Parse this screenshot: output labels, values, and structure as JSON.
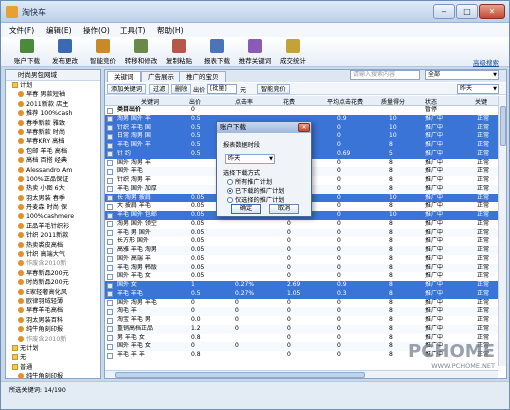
{
  "window": {
    "title": "淘快车",
    "min_label": "‒",
    "max_label": "□",
    "close_label": "✕"
  },
  "menu": [
    "文件(F)",
    "编辑(E)",
    "操作(O)",
    "工具(T)",
    "帮助(H)"
  ],
  "toolbar": {
    "items": [
      {
        "label": "账户下载",
        "icon": "account-download-icon",
        "color": "#4a8a3a"
      },
      {
        "label": "发布更改",
        "icon": "publish-icon",
        "color": "#3a6ab4"
      },
      {
        "label": "智能竞价",
        "icon": "smart-bid-icon",
        "color": "#c88a28"
      },
      {
        "label": "转移和修改",
        "icon": "transfer-icon",
        "color": "#6a8a4a"
      },
      {
        "label": "复制粘贴",
        "icon": "copy-paste-icon",
        "color": "#b4584a"
      },
      {
        "label": "报表下载",
        "icon": "report-download-icon",
        "color": "#4a74b4"
      },
      {
        "label": "推荐关键词",
        "icon": "keyword-icon",
        "color": "#8a5ab4"
      },
      {
        "label": "成交统计",
        "icon": "stats-icon",
        "color": "#c4a23a"
      }
    ],
    "advanced_search": "高级搜索"
  },
  "tree": {
    "header": "时尚男包网域",
    "items": [
      {
        "label": "计划",
        "kind": "folder",
        "state": ""
      },
      {
        "label": "早春 男款短袖",
        "kind": "item",
        "state": ""
      },
      {
        "label": "2011新款 店主",
        "kind": "item",
        "state": ""
      },
      {
        "label": "推荐 100%cash",
        "kind": "item",
        "state": ""
      },
      {
        "label": "春季新款 雅致",
        "kind": "item",
        "state": ""
      },
      {
        "label": "早春新款 时尚",
        "kind": "item",
        "state": ""
      },
      {
        "label": "早春KRY 高档",
        "kind": "item",
        "state": ""
      },
      {
        "label": "包邮 羊毛 高档",
        "kind": "item",
        "state": ""
      },
      {
        "label": "高档 百搭 经典",
        "kind": "item",
        "state": ""
      },
      {
        "label": "Alessandro Am",
        "kind": "item",
        "state": ""
      },
      {
        "label": "100%正品保证",
        "kind": "item",
        "state": ""
      },
      {
        "label": "热卖 小图 6大",
        "kind": "item",
        "state": ""
      },
      {
        "label": "羽太男装 春季",
        "kind": "item",
        "state": ""
      },
      {
        "label": "丹麦森 时尚 保",
        "kind": "item",
        "state": ""
      },
      {
        "label": "100%cashmere",
        "kind": "item",
        "state": ""
      },
      {
        "label": "正品羊毛针织衫",
        "kind": "item",
        "state": ""
      },
      {
        "label": "针织 2011新款",
        "kind": "item",
        "state": ""
      },
      {
        "label": "热卖裘皮高档",
        "kind": "item",
        "state": ""
      },
      {
        "label": "针织 高端大气",
        "kind": "item",
        "state": ""
      },
      {
        "label": "作废含2010新",
        "kind": "item",
        "state": "dim"
      },
      {
        "label": "早春新品200元",
        "kind": "item",
        "state": ""
      },
      {
        "label": "时尚新品200元",
        "kind": "item",
        "state": ""
      },
      {
        "label": "E家轻奢高化风",
        "kind": "item",
        "state": ""
      },
      {
        "label": "欧律羽绒轻薄",
        "kind": "item",
        "state": ""
      },
      {
        "label": "早春羊毛高档",
        "kind": "item",
        "state": ""
      },
      {
        "label": "羽太男装百科",
        "kind": "item",
        "state": ""
      },
      {
        "label": "纯牛角刻印报",
        "kind": "item",
        "state": ""
      },
      {
        "label": "作废含2010新",
        "kind": "item",
        "state": "dim"
      },
      {
        "label": "无计划",
        "kind": "folder",
        "state": ""
      },
      {
        "label": "无",
        "kind": "folder",
        "state": ""
      },
      {
        "label": "普通",
        "kind": "folder",
        "state": ""
      },
      {
        "label": "纯牛角刻印报",
        "kind": "item",
        "state": ""
      },
      {
        "label": "早春新品200元",
        "kind": "item",
        "state": ""
      },
      {
        "label": "超级方阵背景",
        "kind": "item",
        "state": "sel"
      },
      {
        "label": "作废含2010新",
        "kind": "item",
        "state": "dim"
      }
    ]
  },
  "tabs": [
    "关键词",
    "广告展示",
    "推广的宝贝"
  ],
  "search": {
    "placeholder": "请输入搜索内容"
  },
  "filter_combo": "全部",
  "subbar": {
    "add_keyword": "添加关键词",
    "filter": "过滤",
    "delete": "删除",
    "bid_label": "出价",
    "bid_value": "[批量]",
    "unit": "元",
    "smart_bid": "智能竞价",
    "period": "昨天"
  },
  "grid": {
    "headers": [
      "关键词",
      "出价",
      "点击率",
      "花费",
      "平均点击花费",
      "质量得分",
      "状态",
      "关键"
    ],
    "rows": [
      {
        "kw": "类目出价",
        "bid": "0",
        "ctr": "",
        "cost": "",
        "cpc": "",
        "qs": "",
        "status": "暂停",
        "extra": "",
        "style": "bold"
      },
      {
        "kw": "淘男 国外 羊",
        "bid": "0.5",
        "ctr": "",
        "cost": "",
        "cpc": "0.9",
        "qs": "10",
        "status": "推广中",
        "extra": "正常",
        "style": "sel"
      },
      {
        "kw": "针织 羊毛 国",
        "bid": "0.5",
        "ctr": "0",
        "cost": "0",
        "cpc": "0",
        "qs": "10",
        "status": "推广中",
        "extra": "正常",
        "style": "sel"
      },
      {
        "kw": "日常 淘男 国",
        "bid": "0.5",
        "ctr": "0",
        "cost": "0",
        "cpc": "0",
        "qs": "10",
        "status": "推广中",
        "extra": "正常",
        "style": "sel"
      },
      {
        "kw": "羊毛 国外 羊",
        "bid": "0.5",
        "ctr": "",
        "cost": "",
        "cpc": "0",
        "qs": "8",
        "status": "推广中",
        "extra": "正常",
        "style": "sel"
      },
      {
        "kw": "针 约",
        "bid": "0.5",
        "ctr": "",
        "cost": "",
        "cpc": "0.69",
        "qs": "5",
        "status": "推广中",
        "extra": "正常",
        "style": "sel"
      },
      {
        "kw": "国外 淘男 羊",
        "bid": "",
        "ctr": "",
        "cost": "",
        "cpc": "0",
        "qs": "8",
        "status": "推广中",
        "extra": "正常",
        "style": ""
      },
      {
        "kw": "国外 羊毛",
        "bid": "",
        "ctr": "",
        "cost": "",
        "cpc": "0",
        "qs": "8",
        "status": "推广中",
        "extra": "正常",
        "style": "alt"
      },
      {
        "kw": "针织 淘男 羊",
        "bid": "",
        "ctr": "",
        "cost": "",
        "cpc": "0",
        "qs": "8",
        "status": "推广中",
        "extra": "正常",
        "style": ""
      },
      {
        "kw": "羊毛 国外 加厚",
        "bid": "",
        "ctr": "",
        "cost": "",
        "cpc": "0",
        "qs": "8",
        "status": "推广中",
        "extra": "正常",
        "style": "alt"
      },
      {
        "kw": "长 淘男 披肩",
        "bid": "0.05",
        "ctr": "",
        "cost": "",
        "cpc": "0",
        "qs": "10",
        "status": "推广中",
        "extra": "正常",
        "style": "sel"
      },
      {
        "kw": "大 披肩 羊毛",
        "bid": "0.05",
        "ctr": "",
        "cost": "0",
        "cpc": "0",
        "qs": "8",
        "status": "推广中",
        "extra": "正常",
        "style": ""
      },
      {
        "kw": "羊毛 国外 包邮",
        "bid": "0.05",
        "ctr": "0",
        "cost": "0",
        "cpc": "0",
        "qs": "10",
        "status": "推广中",
        "extra": "正常",
        "style": "sel"
      },
      {
        "kw": "淘男 国外 领空",
        "bid": "0.05",
        "ctr": "",
        "cost": "0",
        "cpc": "0",
        "qs": "8",
        "status": "推广中",
        "extra": "正常",
        "style": ""
      },
      {
        "kw": "羊毛 男 国外",
        "bid": "0.05",
        "ctr": "",
        "cost": "0",
        "cpc": "0",
        "qs": "8",
        "status": "推广中",
        "extra": "正常",
        "style": "alt"
      },
      {
        "kw": "长方形 国外",
        "bid": "0.05",
        "ctr": "",
        "cost": "0",
        "cpc": "0",
        "qs": "8",
        "status": "推广中",
        "extra": "正常",
        "style": ""
      },
      {
        "kw": "高雅 羊毛 淘男",
        "bid": "0.05",
        "ctr": "",
        "cost": "0",
        "cpc": "0",
        "qs": "8",
        "status": "推广中",
        "extra": "正常",
        "style": "alt"
      },
      {
        "kw": "国外 高端 羊",
        "bid": "0.05",
        "ctr": "",
        "cost": "0",
        "cpc": "0",
        "qs": "8",
        "status": "推广中",
        "extra": "正常",
        "style": ""
      },
      {
        "kw": "羊毛 淘男 韩版",
        "bid": "0.05",
        "ctr": "",
        "cost": "0",
        "cpc": "0",
        "qs": "8",
        "status": "推广中",
        "extra": "正常",
        "style": "alt"
      },
      {
        "kw": "国外 羊毛 女",
        "bid": "0.05",
        "ctr": "",
        "cost": "0",
        "cpc": "0",
        "qs": "8",
        "status": "推广中",
        "extra": "正常",
        "style": ""
      },
      {
        "kw": "国外 女",
        "bid": "1",
        "ctr": "0.27%",
        "cost": "2.69",
        "cpc": "0.9",
        "qs": "8",
        "status": "推广中",
        "extra": "正常",
        "style": "sel"
      },
      {
        "kw": "羊毛 羊毛",
        "bid": "0.5",
        "ctr": "0.27%",
        "cost": "1.05",
        "cpc": "0.3",
        "qs": "8",
        "status": "推广中",
        "extra": "正常",
        "style": "sel"
      },
      {
        "kw": "国外 淘男 羊毛",
        "bid": "0",
        "ctr": "0",
        "cost": "0",
        "cpc": "0",
        "qs": "8",
        "status": "推广中",
        "extra": "正常",
        "style": ""
      },
      {
        "kw": "淘毛 羊",
        "bid": "0",
        "ctr": "0",
        "cost": "0",
        "cpc": "0",
        "qs": "8",
        "status": "推广中",
        "extra": "正常",
        "style": "alt"
      },
      {
        "kw": "淘宝 羊毛 男",
        "bid": "0.0",
        "ctr": "0",
        "cost": "0",
        "cpc": "0",
        "qs": "8",
        "status": "推广中",
        "extra": "正常",
        "style": ""
      },
      {
        "kw": "重销高档正品",
        "bid": "1.2",
        "ctr": "0",
        "cost": "0",
        "cpc": "0",
        "qs": "8",
        "status": "推广中",
        "extra": "正常",
        "style": "alt"
      },
      {
        "kw": "男 羊毛 女",
        "bid": "0.8",
        "ctr": "",
        "cost": "0",
        "cpc": "0",
        "qs": "8",
        "status": "推广中",
        "extra": "正常",
        "style": ""
      },
      {
        "kw": "国外 羊毛 女",
        "bid": "0",
        "ctr": "0",
        "cost": "0",
        "cpc": "0",
        "qs": "8",
        "status": "推广中",
        "extra": "正常",
        "style": "alt"
      },
      {
        "kw": "羊毛 羊 羊",
        "bid": "0.8",
        "ctr": "",
        "cost": "0",
        "cpc": "0",
        "qs": "8",
        "status": "推广中",
        "extra": "正常",
        "style": ""
      }
    ]
  },
  "dialog": {
    "title": "账户下载",
    "close_label": "✕",
    "range_label": "报表数据时段",
    "range_value": "昨天",
    "mode_label": "选择下载方式",
    "options": [
      "所有推广计划",
      "已下载的推广计划",
      "仅选择的推广计划"
    ],
    "selected_option": 1,
    "ok_label": "确定",
    "cancel_label": "取消"
  },
  "status": {
    "text": "所选关键词: 14/190"
  },
  "watermark": {
    "logo": "PCHOME",
    "url": "WWW.PCHOME.NET"
  }
}
